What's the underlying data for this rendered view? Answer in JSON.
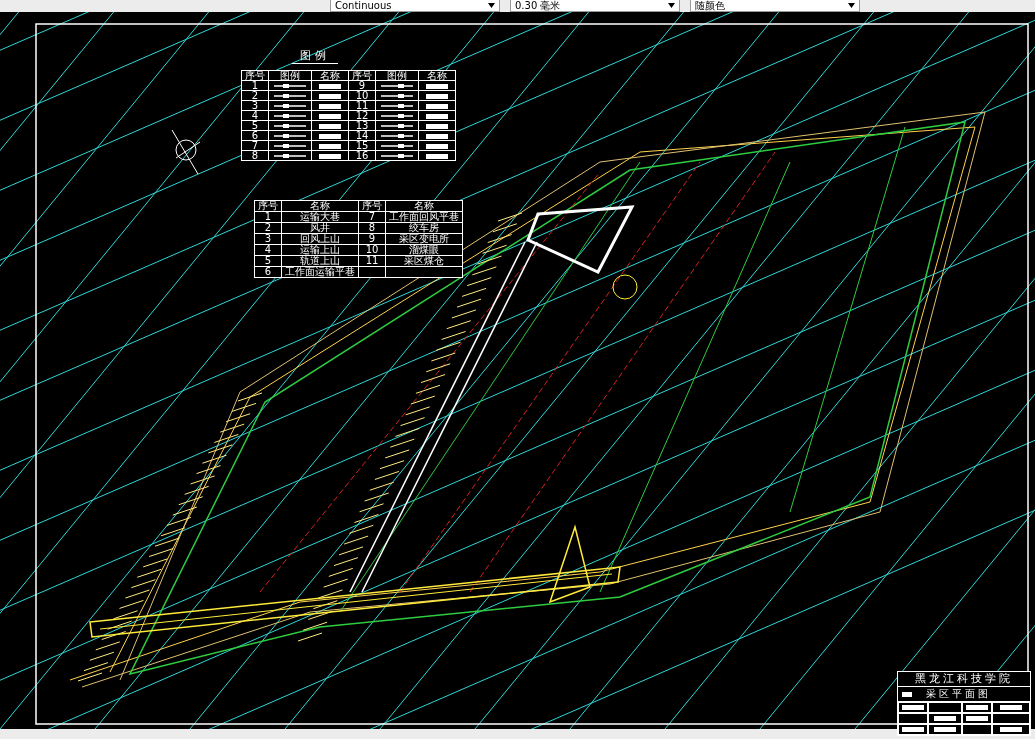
{
  "toolbar": {
    "combos": [
      {
        "value": "Continuous"
      },
      {
        "value": "0.30 毫米"
      },
      {
        "value": "随颜色"
      }
    ]
  },
  "legend": {
    "title": "图例",
    "columns": [
      "序号",
      "图例",
      "名称",
      "序号",
      "图例",
      "名称"
    ],
    "rows": [
      {
        "left_no": "1",
        "right_no": "9"
      },
      {
        "left_no": "2",
        "right_no": "10"
      },
      {
        "left_no": "3",
        "right_no": "11"
      },
      {
        "left_no": "4",
        "right_no": "12"
      },
      {
        "left_no": "5",
        "right_no": "13"
      },
      {
        "left_no": "6",
        "right_no": "14"
      },
      {
        "left_no": "7",
        "right_no": "15"
      },
      {
        "left_no": "8",
        "right_no": "16"
      }
    ]
  },
  "roadways": {
    "columns": [
      "序号",
      "名称",
      "序号",
      "名称"
    ],
    "rows": [
      {
        "no_a": "1",
        "name_a": "运输大巷",
        "no_b": "7",
        "name_b": "工作面回风平巷"
      },
      {
        "no_a": "2",
        "name_a": "风井",
        "no_b": "8",
        "name_b": "绞车房"
      },
      {
        "no_a": "3",
        "name_a": "回风上山",
        "no_b": "9",
        "name_b": "采区变电所"
      },
      {
        "no_a": "4",
        "name_a": "运输上山",
        "no_b": "10",
        "name_b": "溜煤眼"
      },
      {
        "no_a": "5",
        "name_a": "轨道上山",
        "no_b": "11",
        "name_b": "采区煤仓"
      },
      {
        "no_a": "6",
        "name_a": "工作面运输平巷",
        "no_b": "",
        "name_b": ""
      }
    ]
  },
  "title_block": {
    "school": "黑龙江科技学院",
    "drawing_title": "采区平面图"
  }
}
